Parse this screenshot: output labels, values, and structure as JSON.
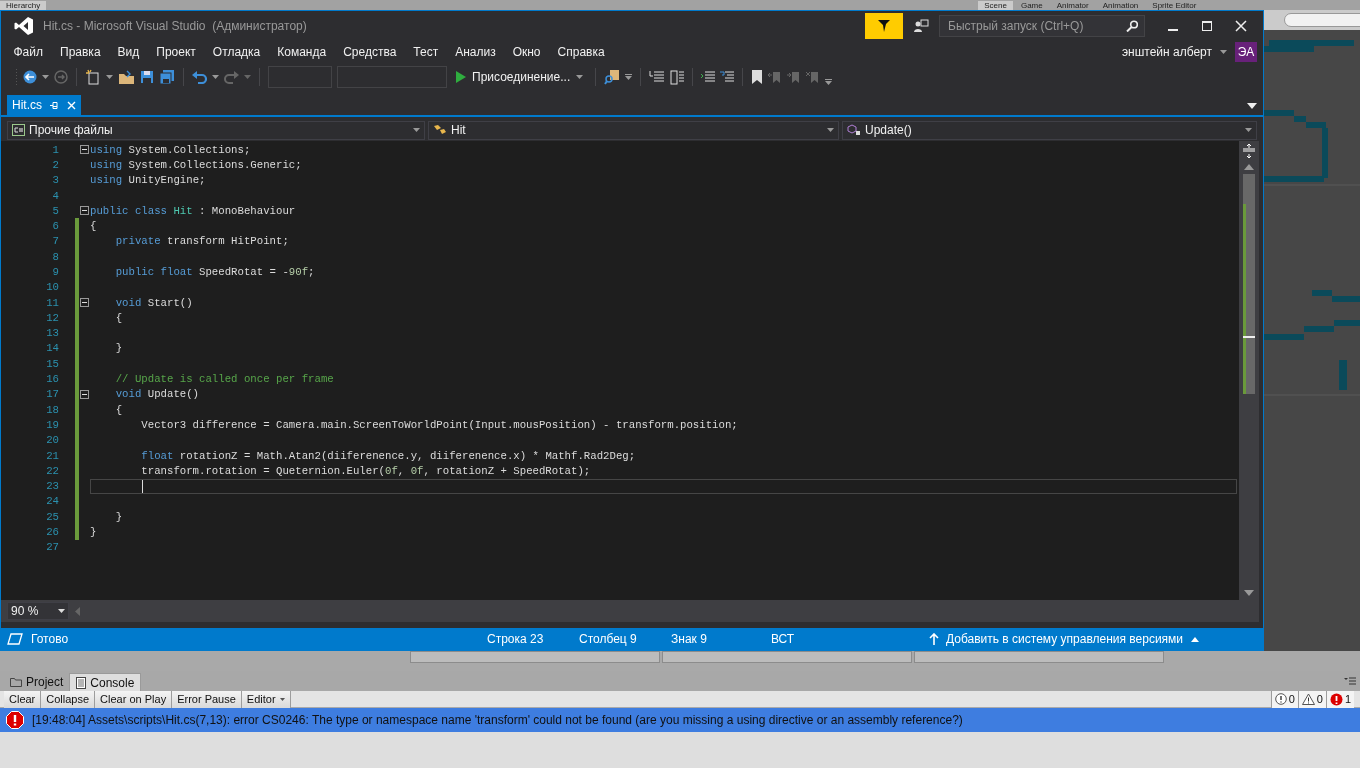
{
  "unity_tabs": [
    {
      "label": "Hierarchy",
      "selected": true
    },
    {
      "label": "Scene",
      "selected": true
    },
    {
      "label": "Game",
      "selected": false
    },
    {
      "label": "Animator",
      "selected": false
    },
    {
      "label": "Animation",
      "selected": false
    },
    {
      "label": "Sprite Editor",
      "selected": false
    }
  ],
  "window": {
    "title": "Hit.cs - Microsoft Visual Studio  (Администратор)"
  },
  "quick_launch": {
    "placeholder": "Быстрый запуск (Ctrl+Q)"
  },
  "menu": [
    "Файл",
    "Правка",
    "Вид",
    "Проект",
    "Отладка",
    "Команда",
    "Средства",
    "Тест",
    "Анализ",
    "Окно",
    "Справка"
  ],
  "account": {
    "name": "энштейн алберт",
    "initials": "ЭА"
  },
  "toolbar": {
    "attach_button": "Присоединение..."
  },
  "document_tabs": [
    {
      "label": "Hit.cs",
      "selected": true
    }
  ],
  "nav_bar": [
    {
      "kind": "project",
      "label": "Прочие файлы"
    },
    {
      "kind": "class",
      "label": "Hit"
    },
    {
      "kind": "method",
      "label": "Update()"
    }
  ],
  "code": {
    "lines": [
      {
        "number": "1",
        "changed": false,
        "current": false,
        "collapsible": true,
        "tokens": [
          {
            "kind": "keyword",
            "text": "using"
          },
          {
            "kind": "plain",
            "text": " System.Collections;"
          }
        ]
      },
      {
        "number": "2",
        "changed": false,
        "current": false,
        "collapsible": false,
        "tokens": [
          {
            "kind": "keyword",
            "text": "using"
          },
          {
            "kind": "plain",
            "text": " System.Collections.Generic;"
          }
        ]
      },
      {
        "number": "3",
        "changed": false,
        "current": false,
        "collapsible": false,
        "tokens": [
          {
            "kind": "keyword",
            "text": "using"
          },
          {
            "kind": "plain",
            "text": " UnityEngine;"
          }
        ]
      },
      {
        "number": "4",
        "changed": false,
        "current": false,
        "collapsible": false
      },
      {
        "number": "5",
        "changed": false,
        "current": false,
        "collapsible": true,
        "tokens": [
          {
            "kind": "keyword",
            "text": "public class"
          },
          {
            "kind": "type",
            "text": " Hit"
          },
          {
            "kind": "plain",
            "text": " : MonoBehaviour"
          }
        ]
      },
      {
        "number": "6",
        "changed": true,
        "current": false,
        "collapsible": false,
        "tokens": [
          {
            "kind": "plain",
            "text": "{"
          }
        ]
      },
      {
        "number": "7",
        "changed": true,
        "current": false,
        "collapsible": false,
        "tokens": [
          {
            "kind": "keyword",
            "text": "    private"
          },
          {
            "kind": "plain",
            "text": " transform HitPoint;"
          }
        ]
      },
      {
        "number": "8",
        "changed": true,
        "current": false,
        "collapsible": false
      },
      {
        "number": "9",
        "changed": true,
        "current": false,
        "collapsible": false,
        "tokens": [
          {
            "kind": "keyword",
            "text": "    public float"
          },
          {
            "kind": "plain",
            "text": " SpeedRotat = -"
          },
          {
            "kind": "number",
            "text": "90f"
          },
          {
            "kind": "plain",
            "text": ";"
          }
        ]
      },
      {
        "number": "10",
        "changed": true,
        "current": false,
        "collapsible": false
      },
      {
        "number": "11",
        "changed": true,
        "current": false,
        "collapsible": true,
        "tokens": [
          {
            "kind": "keyword",
            "text": "    void"
          },
          {
            "kind": "plain",
            "text": " Start()"
          }
        ]
      },
      {
        "number": "12",
        "changed": true,
        "current": false,
        "collapsible": false,
        "tokens": [
          {
            "kind": "plain",
            "text": "    {"
          }
        ]
      },
      {
        "number": "13",
        "changed": true,
        "current": false,
        "collapsible": false
      },
      {
        "number": "14",
        "changed": true,
        "current": false,
        "collapsible": false,
        "tokens": [
          {
            "kind": "plain",
            "text": "    }"
          }
        ]
      },
      {
        "number": "15",
        "changed": true,
        "current": false,
        "collapsible": false
      },
      {
        "number": "16",
        "changed": true,
        "current": false,
        "collapsible": false,
        "tokens": [
          {
            "kind": "comment",
            "text": "    // Update is called once per frame"
          }
        ]
      },
      {
        "number": "17",
        "changed": true,
        "current": false,
        "collapsible": true,
        "tokens": [
          {
            "kind": "keyword",
            "text": "    void"
          },
          {
            "kind": "plain",
            "text": " Update()"
          }
        ]
      },
      {
        "number": "18",
        "changed": true,
        "current": false,
        "collapsible": false,
        "tokens": [
          {
            "kind": "plain",
            "text": "    {"
          }
        ]
      },
      {
        "number": "19",
        "changed": true,
        "current": false,
        "collapsible": false,
        "tokens": [
          {
            "kind": "plain",
            "text": "        Vector3 difference = Camera.main.ScreenToWorldPoint(Input.mousPosition) - transform.position;"
          }
        ]
      },
      {
        "number": "20",
        "changed": true,
        "current": false,
        "collapsible": false
      },
      {
        "number": "21",
        "changed": true,
        "current": false,
        "collapsible": false,
        "tokens": [
          {
            "kind": "keyword",
            "text": "        float"
          },
          {
            "kind": "plain",
            "text": " rotationZ = Math.Atan2(diiferenence.y, diiferenence.x) * Mathf.Rad2Deg;"
          }
        ]
      },
      {
        "number": "22",
        "changed": true,
        "current": false,
        "collapsible": false,
        "tokens": [
          {
            "kind": "plain",
            "text": "        transform.rotation = Queternion.Euler("
          },
          {
            "kind": "number",
            "text": "0f"
          },
          {
            "kind": "plain",
            "text": ", "
          },
          {
            "kind": "number",
            "text": "0f"
          },
          {
            "kind": "plain",
            "text": ", rotationZ + SpeedRotat);"
          }
        ]
      },
      {
        "number": "23",
        "changed": true,
        "current": true,
        "collapsible": false
      },
      {
        "number": "24",
        "changed": true,
        "current": false,
        "collapsible": false
      },
      {
        "number": "25",
        "changed": true,
        "current": false,
        "collapsible": false,
        "tokens": [
          {
            "kind": "plain",
            "text": "    }"
          }
        ]
      },
      {
        "number": "26",
        "changed": true,
        "current": false,
        "collapsible": false,
        "tokens": [
          {
            "kind": "plain",
            "text": "}"
          }
        ]
      },
      {
        "number": "27",
        "changed": false,
        "current": false,
        "collapsible": false
      }
    ]
  },
  "zoom": "90 %",
  "status_bar": {
    "message": "Готово",
    "line": "Строка 23",
    "column": "Столбец 9",
    "char": "Знак 9",
    "mode": "ВСТ",
    "source_control": "Добавить в систему управления версиями"
  },
  "console": {
    "tabs": [
      {
        "kind": "project",
        "label": "Project",
        "selected": false
      },
      {
        "kind": "console",
        "label": "Console",
        "selected": true
      }
    ],
    "buttons": [
      {
        "label": "Clear",
        "has_menu": false
      },
      {
        "label": "Collapse",
        "has_menu": false
      },
      {
        "label": "Clear on Play",
        "has_menu": false
      },
      {
        "label": "Error Pause",
        "has_menu": false
      },
      {
        "label": "Editor",
        "has_menu": true
      }
    ],
    "counters": [
      {
        "kind": "info",
        "count": "0"
      },
      {
        "kind": "warning",
        "count": "0"
      },
      {
        "kind": "error",
        "count": "1"
      }
    ],
    "entries": [
      {
        "kind": "error",
        "selected": true,
        "text": "[19:48:04] Assets\\scripts\\Hit.cs(7,13): error CS0246: The type or namespace name 'transform' could not be found (are you missing a using directive or an assembly reference?)"
      }
    ]
  }
}
